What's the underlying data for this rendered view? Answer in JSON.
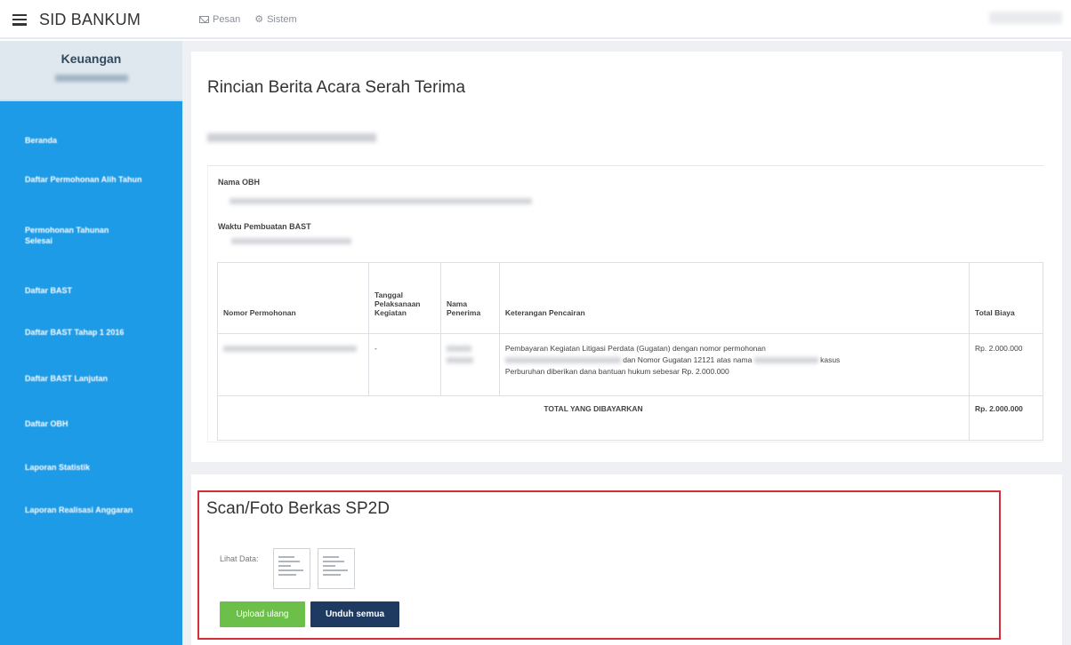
{
  "header": {
    "app_title": "SID BANKUM",
    "nav": [
      {
        "label": "Pesan",
        "icon": "envelope-icon"
      },
      {
        "label": "Sistem",
        "icon": "gear-icon"
      }
    ]
  },
  "sidebar": {
    "profile_title": "Keuangan",
    "items": [
      {
        "label": "Beranda"
      },
      {
        "label": "Daftar Permohonan Alih Tahun"
      },
      {
        "label": "Permohonan Tahunan Selesai"
      },
      {
        "label": "Daftar BAST"
      },
      {
        "label": "Daftar BAST Tahap 1 2016"
      },
      {
        "label": "Daftar BAST Lanjutan"
      },
      {
        "label": "Daftar OBH"
      },
      {
        "label": "Laporan Statistik"
      },
      {
        "label": "Laporan Realisasi Anggaran"
      }
    ]
  },
  "detail": {
    "title": "Rincian Berita Acara Serah Terima",
    "nama_obh_label": "Nama OBH",
    "waktu_label": "Waktu Pembuatan BAST"
  },
  "table": {
    "headers": [
      "Nomor Permohonan",
      "Tanggal Pelaksanaan Kegiatan",
      "Nama Penerima",
      "Keterangan Pencairan",
      "Total Biaya"
    ],
    "row": {
      "tanggal": "-",
      "keterangan_1": "Pembayaran Kegiatan Litigasi Perdata (Gugatan) dengan nomor permohonan",
      "keterangan_2": "dan Nomor Gugatan 12121 atas nama",
      "keterangan_3": "kasus",
      "keterangan_4": "Perburuhan diberikan dana bantuan hukum sebesar Rp. 2.000.000",
      "total": "Rp. 2.000.000"
    },
    "total_label": "TOTAL YANG DIBAYARKAN",
    "total_value": "Rp. 2.000.000"
  },
  "scan": {
    "title": "Scan/Foto Berkas SP2D",
    "lihat_label": "Lihat Data:",
    "upload_label": "Upload ulang",
    "unduh_label": "Unduh semua"
  }
}
